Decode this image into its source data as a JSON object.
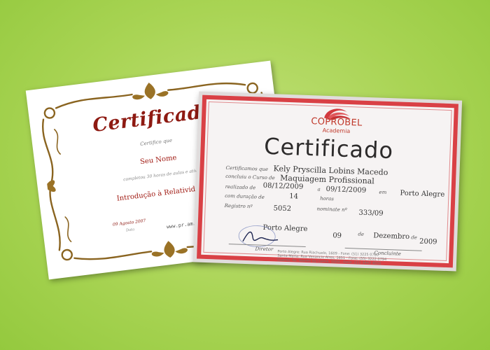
{
  "back_certificate": {
    "title": "Certificado",
    "certify_text": "Certifico que",
    "name": "Seu Nome",
    "completed_text": "completou 30 horas de aulas e ativ",
    "course": "Introdução à Relatividade",
    "date": "09 Agosto 2007",
    "date_label": "Data",
    "url": "www.pr.am.c"
  },
  "front_certificate": {
    "brand": "COPROBEL",
    "brand_sub": "Academia",
    "title": "Certificado",
    "certify_label": "Certificamos que",
    "name": "Kely Pryscilla Lobins Macedo",
    "completed_label": "concluiu o Curso de",
    "course": "Maquiagem Profissional",
    "held_label": "realizado de",
    "start_date": "08/12/2009",
    "to_label": "a",
    "end_date": "09/12/2009",
    "in_label": "em",
    "city": "Porto Alegre",
    "duration_label": "com duração de",
    "duration": "14",
    "hours_label": "horas",
    "registry_label": "Registro nº",
    "registry": "5052",
    "nominate_label": "nominate nº",
    "nominate": "333/09",
    "place": "Porto Alegre",
    "day": "09",
    "de1": "de",
    "month": "Dezembro",
    "de2": "de",
    "year": "2009",
    "director_label": "Diretor",
    "student_label": "Concluinte",
    "footer_lines": [
      "Porto Alegre: Rua Riachuelo, 1609 - Fone: (51) 3225 0760",
      "Santa Maria: Rua Venancio Aires, 1651 - Fone: (55) 3222 0794",
      "Guarda: Av. Hoeres da Cunha, 1004 - Fone: (51) 3443 4031"
    ]
  }
}
